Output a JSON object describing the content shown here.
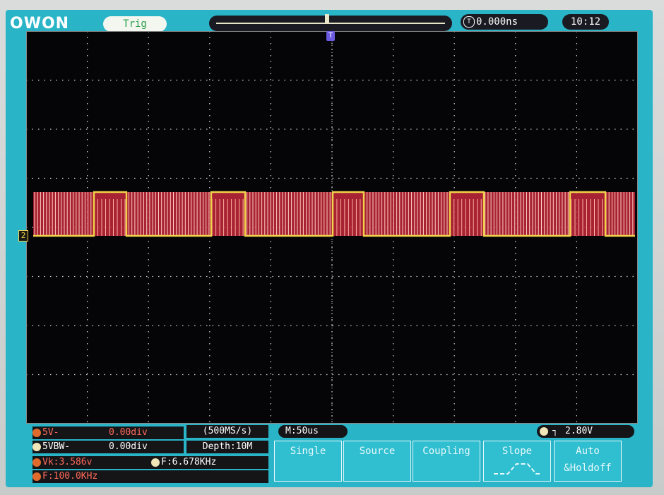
{
  "brand": "OWON",
  "top_bar": {
    "trigger_status": "Trig",
    "trigger_time": "0.000ns",
    "clock": "10:12",
    "trigger_marker": "T"
  },
  "channel": {
    "label": "2",
    "color": "#f2d24a",
    "fill_color": "#c4283a"
  },
  "status": {
    "row1_left": "5V-",
    "row1_val": "0.00div",
    "row2_left": "5VBW-",
    "row2_val": "0.00div",
    "sample_rate": "(500MS/s)",
    "depth": "Depth:10M",
    "vk": "Vk:3.586v",
    "freq_a": "F:6.678KHz",
    "freq_b": "F:100.0KHz",
    "timebase": "M:50us",
    "trigger_level": "2.80V"
  },
  "menu": {
    "single": "Single",
    "source": "Source",
    "coupling": "Coupling",
    "slope": "Slope",
    "auto": "Auto",
    "holdoff": "&Holdoff"
  }
}
